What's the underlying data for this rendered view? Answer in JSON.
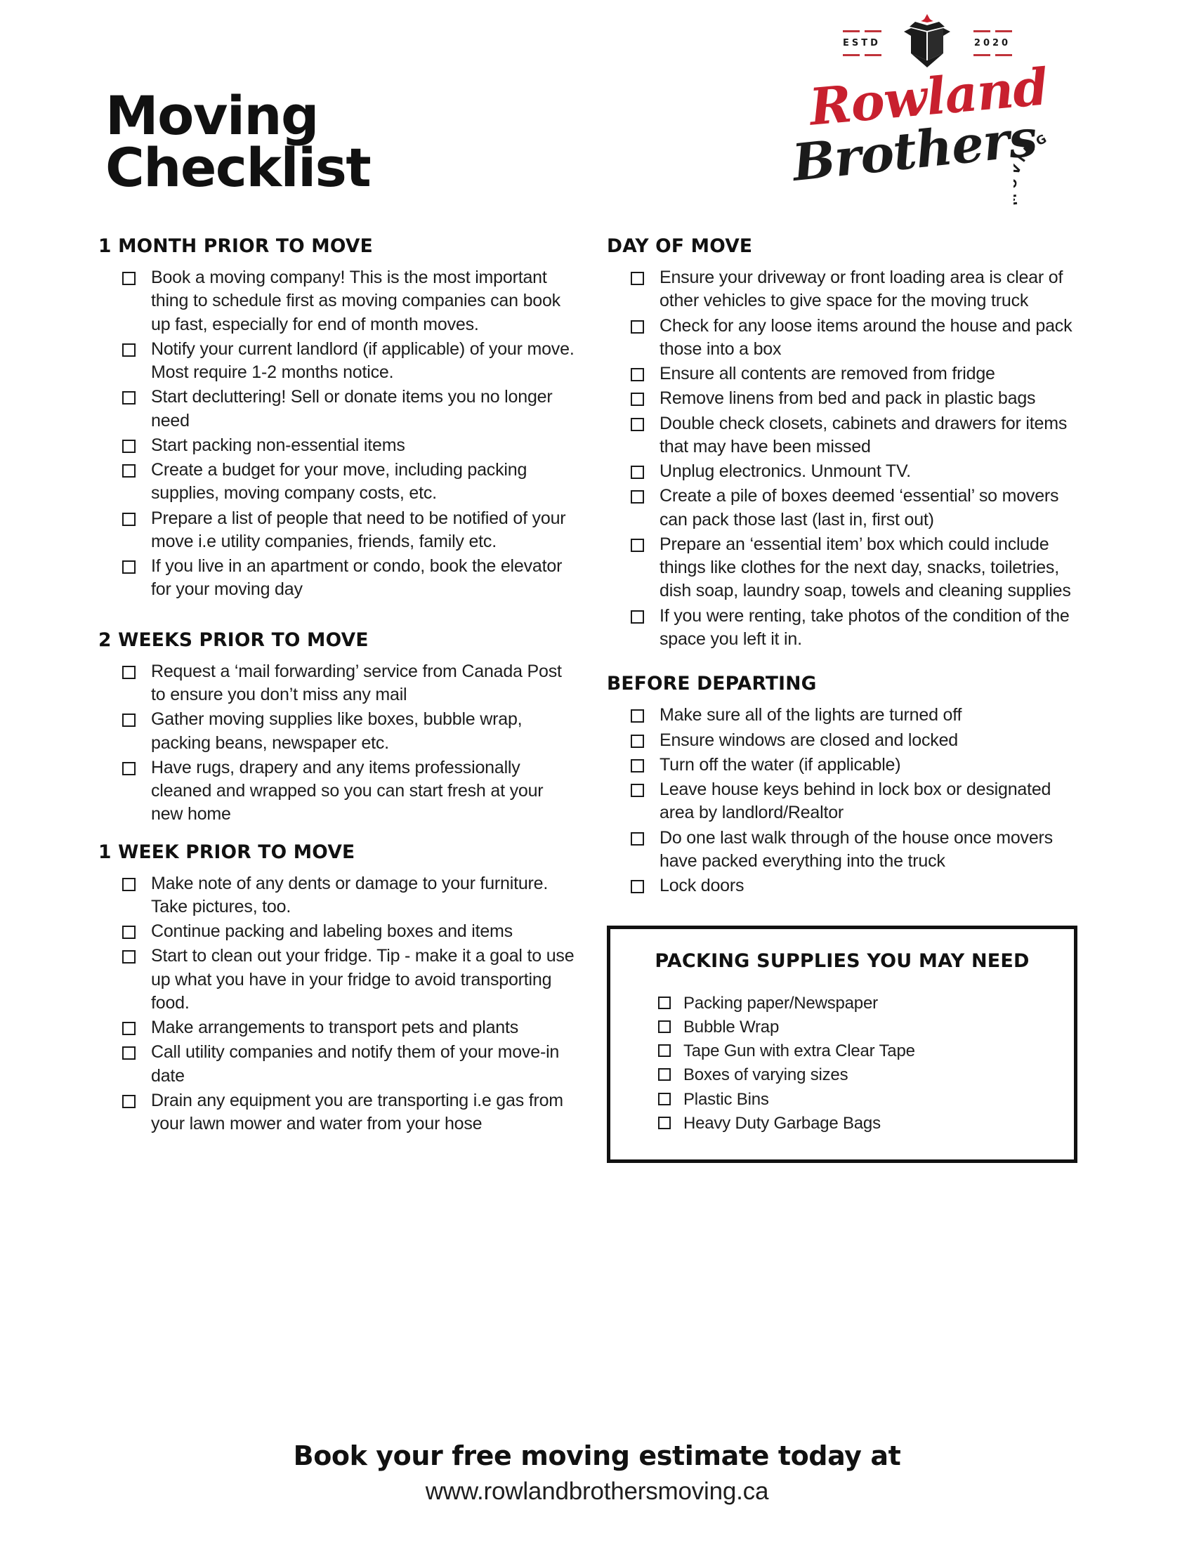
{
  "document": {
    "title_line1": "Moving",
    "title_line2": "Checklist"
  },
  "logo": {
    "estd_label": "ESTD",
    "estd_year": "2020",
    "brand_line1": "Rowland",
    "brand_line2": "Brothers",
    "brand_tagline": "MOVING",
    "brand_red": "#C8202E",
    "brand_black": "#1B1B1B",
    "accent_dash_color": "#C0333A",
    "box_icon": "open-box-icon",
    "leaf_icon": "maple-leaf-icon"
  },
  "sections": [
    {
      "id": "one-month-prior",
      "heading": "1 MONTH PRIOR TO MOVE",
      "items": [
        "Book a moving company! This is the most important thing to schedule first as moving companies can book up fast, especially for end of month moves.",
        "Notify your current landlord (if applicable) of your move. Most require 1-2 months notice.",
        "Start decluttering! Sell or donate items you no longer need",
        "Start packing non-essential items",
        "Create a budget for your move, including packing supplies, moving company costs, etc.",
        "Prepare a list of people that need to be notified of your move i.e utility companies, friends, family etc.",
        "If you live in an apartment or condo, book the elevator for your moving day"
      ]
    },
    {
      "id": "two-weeks-prior",
      "heading": "2 WEEKS PRIOR TO MOVE",
      "items": [
        "Request a ‘mail forwarding’ service from Canada Post to ensure you don’t miss any mail",
        "Gather moving supplies like boxes, bubble wrap, packing beans, newspaper etc.",
        "Have rugs, drapery and any items professionally cleaned and wrapped so you can start fresh at your new home"
      ]
    },
    {
      "id": "one-week-prior",
      "heading": "1 WEEK PRIOR TO MOVE",
      "items": [
        "Make note of any dents or damage to your furniture. Take pictures, too.",
        "Continue packing and labeling boxes and items",
        "Start to clean out your fridge. Tip - make it a goal to use up what you have in your fridge to avoid transporting food.",
        "Make arrangements to transport pets and plants",
        "Call utility companies and notify them of your move-in date",
        "Drain any equipment you are transporting i.e gas from your lawn mower and water from your hose"
      ]
    },
    {
      "id": "day-of-move",
      "heading": "DAY OF MOVE",
      "items": [
        "Ensure your driveway or front loading area is clear of other vehicles to give space for the moving truck",
        "Check for any loose items around the house and pack those into a box",
        "Ensure all contents are removed from fridge",
        "Remove linens from bed and pack in plastic bags",
        "Double check closets, cabinets and drawers for items that may have been missed",
        "Unplug electronics. Unmount TV.",
        "Create a pile of boxes deemed ‘essential’ so movers can pack those last (last in, first out)",
        "Prepare an ‘essential item’ box which could include things like clothes for the next day, snacks, toiletries, dish soap, laundry soap, towels and cleaning supplies",
        "If you were renting, take photos of the condition of the space you left it in."
      ]
    },
    {
      "id": "before-departing",
      "heading": "BEFORE DEPARTING",
      "items": [
        "Make sure all of the lights are turned off",
        "Ensure windows are closed and locked",
        "Turn off the water (if applicable)",
        "Leave house keys behind in lock box or designated area by landlord/Realtor",
        "Do one last walk through of the house once movers have packed everything into the truck",
        "Lock doors"
      ]
    }
  ],
  "supplies_box": {
    "title": "PACKING SUPPLIES YOU MAY NEED",
    "items": [
      "Packing paper/Newspaper",
      "Bubble Wrap",
      "Tape Gun with extra Clear Tape",
      "Boxes of varying sizes",
      "Plastic Bins",
      "Heavy Duty Garbage Bags"
    ]
  },
  "footer": {
    "cta": "Book your free moving estimate today at",
    "url": "www.rowlandbrothersmoving.ca"
  }
}
